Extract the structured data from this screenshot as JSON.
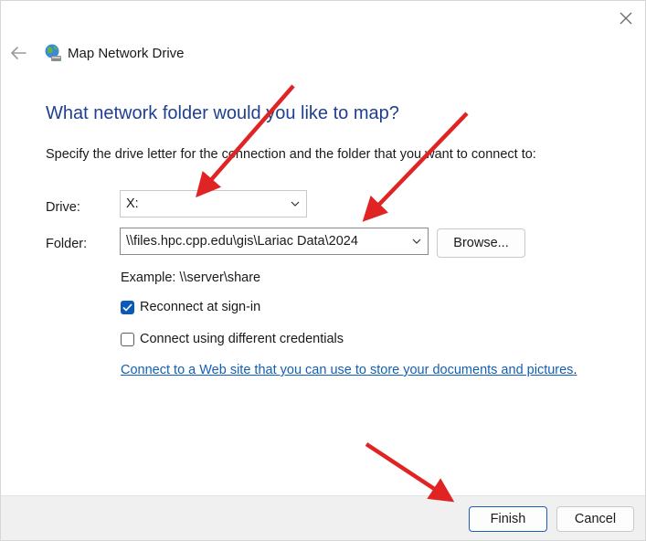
{
  "window": {
    "title": "Map Network Drive",
    "icons": {
      "close": "close-icon",
      "back": "back-arrow-icon",
      "app": "network-drive-icon"
    }
  },
  "main": {
    "heading": "What network folder would you like to map?",
    "instructions": "Specify the drive letter for the connection and the folder that you want to connect to:",
    "drive": {
      "label": "Drive:",
      "value": "X:"
    },
    "folder": {
      "label": "Folder:",
      "value": "\\\\files.hpc.cpp.edu\\gis\\Lariac Data\\2024",
      "browse_label": "Browse..."
    },
    "example": "Example: \\\\server\\share",
    "reconnect": {
      "label": "Reconnect at sign-in",
      "checked": true
    },
    "credentials": {
      "label": "Connect using different credentials",
      "checked": false
    },
    "web_link": "Connect to a Web site that you can use to store your documents and pictures",
    "web_link_suffix": "."
  },
  "footer": {
    "finish_label": "Finish",
    "cancel_label": "Cancel"
  },
  "colors": {
    "heading": "#1f3f8f",
    "link": "#1060b8",
    "checkbox_checked": "#0a5ab8",
    "annotation_arrow": "#e02424"
  }
}
